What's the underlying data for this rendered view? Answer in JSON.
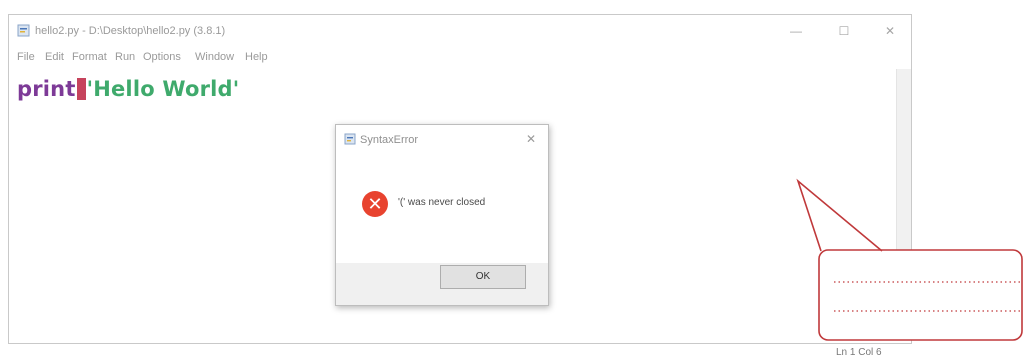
{
  "window": {
    "title": "hello2.py - D:\\Desktop\\hello2.py (3.8.1)",
    "minimize_glyph": "—",
    "maximize_glyph": "☐",
    "close_glyph": "✕"
  },
  "menu": [
    "File",
    "Edit",
    "Format",
    "Run",
    "Options",
    "Window",
    "Help"
  ],
  "editor": {
    "keyword": "print",
    "string": "'Hello World'"
  },
  "dialog": {
    "title": "SyntaxError",
    "close_glyph": "✕",
    "message": "'(' was never closed",
    "ok_label": "OK",
    "icon": "error-x-icon"
  },
  "status": {
    "text": "Ln 1  Col 6"
  },
  "colors": {
    "keyword": "#7d3a97",
    "string": "#3faa6c",
    "error_highlight": "#c6435c",
    "error_icon": "#e8432f",
    "callout": "#c0393b"
  }
}
